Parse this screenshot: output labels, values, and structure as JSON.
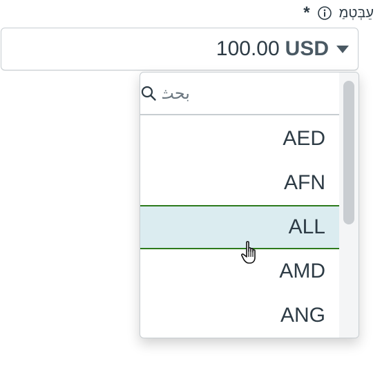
{
  "field": {
    "label": "עֵבְּטְמַ",
    "required_marker": "*",
    "amount": "100.00",
    "currency": "USD"
  },
  "dropdown": {
    "search_placeholder": "بحث",
    "options": [
      "AED",
      "AFN",
      "ALL",
      "AMD",
      "ANG"
    ],
    "highlighted_option": "ALL"
  },
  "icons": {
    "info": "info-icon",
    "caret": "caret-down-icon",
    "search": "search-icon",
    "cursor": "hand-pointer-cursor"
  },
  "colors": {
    "text": "#2d3b45",
    "highlight_bg": "#dbecf0",
    "highlight_border": "#2c7a1b",
    "border": "#c7cdd1"
  }
}
